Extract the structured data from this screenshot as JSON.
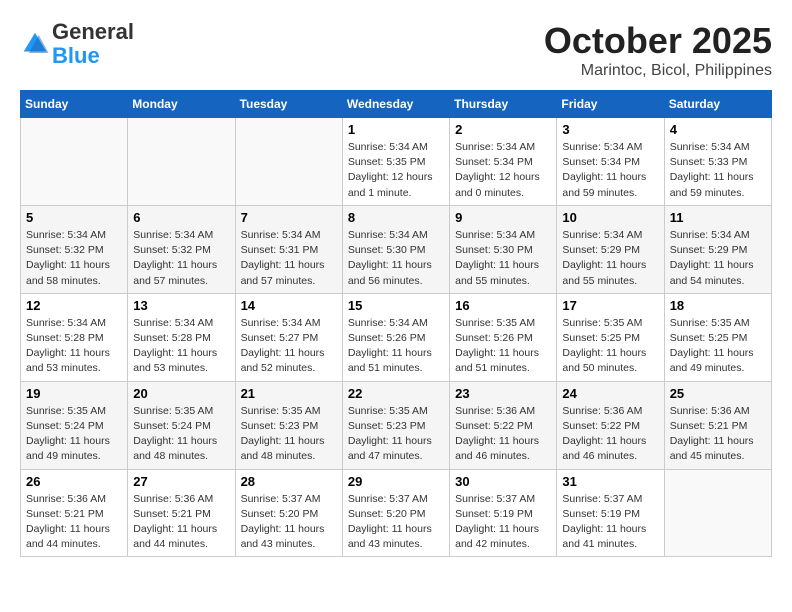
{
  "logo": {
    "general": "General",
    "blue": "Blue"
  },
  "header": {
    "month": "October 2025",
    "location": "Marintoc, Bicol, Philippines"
  },
  "weekdays": [
    "Sunday",
    "Monday",
    "Tuesday",
    "Wednesday",
    "Thursday",
    "Friday",
    "Saturday"
  ],
  "weeks": [
    [
      {
        "day": "",
        "info": ""
      },
      {
        "day": "",
        "info": ""
      },
      {
        "day": "",
        "info": ""
      },
      {
        "day": "1",
        "info": "Sunrise: 5:34 AM\nSunset: 5:35 PM\nDaylight: 12 hours\nand 1 minute."
      },
      {
        "day": "2",
        "info": "Sunrise: 5:34 AM\nSunset: 5:34 PM\nDaylight: 12 hours\nand 0 minutes."
      },
      {
        "day": "3",
        "info": "Sunrise: 5:34 AM\nSunset: 5:34 PM\nDaylight: 11 hours\nand 59 minutes."
      },
      {
        "day": "4",
        "info": "Sunrise: 5:34 AM\nSunset: 5:33 PM\nDaylight: 11 hours\nand 59 minutes."
      }
    ],
    [
      {
        "day": "5",
        "info": "Sunrise: 5:34 AM\nSunset: 5:32 PM\nDaylight: 11 hours\nand 58 minutes."
      },
      {
        "day": "6",
        "info": "Sunrise: 5:34 AM\nSunset: 5:32 PM\nDaylight: 11 hours\nand 57 minutes."
      },
      {
        "day": "7",
        "info": "Sunrise: 5:34 AM\nSunset: 5:31 PM\nDaylight: 11 hours\nand 57 minutes."
      },
      {
        "day": "8",
        "info": "Sunrise: 5:34 AM\nSunset: 5:30 PM\nDaylight: 11 hours\nand 56 minutes."
      },
      {
        "day": "9",
        "info": "Sunrise: 5:34 AM\nSunset: 5:30 PM\nDaylight: 11 hours\nand 55 minutes."
      },
      {
        "day": "10",
        "info": "Sunrise: 5:34 AM\nSunset: 5:29 PM\nDaylight: 11 hours\nand 55 minutes."
      },
      {
        "day": "11",
        "info": "Sunrise: 5:34 AM\nSunset: 5:29 PM\nDaylight: 11 hours\nand 54 minutes."
      }
    ],
    [
      {
        "day": "12",
        "info": "Sunrise: 5:34 AM\nSunset: 5:28 PM\nDaylight: 11 hours\nand 53 minutes."
      },
      {
        "day": "13",
        "info": "Sunrise: 5:34 AM\nSunset: 5:28 PM\nDaylight: 11 hours\nand 53 minutes."
      },
      {
        "day": "14",
        "info": "Sunrise: 5:34 AM\nSunset: 5:27 PM\nDaylight: 11 hours\nand 52 minutes."
      },
      {
        "day": "15",
        "info": "Sunrise: 5:34 AM\nSunset: 5:26 PM\nDaylight: 11 hours\nand 51 minutes."
      },
      {
        "day": "16",
        "info": "Sunrise: 5:35 AM\nSunset: 5:26 PM\nDaylight: 11 hours\nand 51 minutes."
      },
      {
        "day": "17",
        "info": "Sunrise: 5:35 AM\nSunset: 5:25 PM\nDaylight: 11 hours\nand 50 minutes."
      },
      {
        "day": "18",
        "info": "Sunrise: 5:35 AM\nSunset: 5:25 PM\nDaylight: 11 hours\nand 49 minutes."
      }
    ],
    [
      {
        "day": "19",
        "info": "Sunrise: 5:35 AM\nSunset: 5:24 PM\nDaylight: 11 hours\nand 49 minutes."
      },
      {
        "day": "20",
        "info": "Sunrise: 5:35 AM\nSunset: 5:24 PM\nDaylight: 11 hours\nand 48 minutes."
      },
      {
        "day": "21",
        "info": "Sunrise: 5:35 AM\nSunset: 5:23 PM\nDaylight: 11 hours\nand 48 minutes."
      },
      {
        "day": "22",
        "info": "Sunrise: 5:35 AM\nSunset: 5:23 PM\nDaylight: 11 hours\nand 47 minutes."
      },
      {
        "day": "23",
        "info": "Sunrise: 5:36 AM\nSunset: 5:22 PM\nDaylight: 11 hours\nand 46 minutes."
      },
      {
        "day": "24",
        "info": "Sunrise: 5:36 AM\nSunset: 5:22 PM\nDaylight: 11 hours\nand 46 minutes."
      },
      {
        "day": "25",
        "info": "Sunrise: 5:36 AM\nSunset: 5:21 PM\nDaylight: 11 hours\nand 45 minutes."
      }
    ],
    [
      {
        "day": "26",
        "info": "Sunrise: 5:36 AM\nSunset: 5:21 PM\nDaylight: 11 hours\nand 44 minutes."
      },
      {
        "day": "27",
        "info": "Sunrise: 5:36 AM\nSunset: 5:21 PM\nDaylight: 11 hours\nand 44 minutes."
      },
      {
        "day": "28",
        "info": "Sunrise: 5:37 AM\nSunset: 5:20 PM\nDaylight: 11 hours\nand 43 minutes."
      },
      {
        "day": "29",
        "info": "Sunrise: 5:37 AM\nSunset: 5:20 PM\nDaylight: 11 hours\nand 43 minutes."
      },
      {
        "day": "30",
        "info": "Sunrise: 5:37 AM\nSunset: 5:19 PM\nDaylight: 11 hours\nand 42 minutes."
      },
      {
        "day": "31",
        "info": "Sunrise: 5:37 AM\nSunset: 5:19 PM\nDaylight: 11 hours\nand 41 minutes."
      },
      {
        "day": "",
        "info": ""
      }
    ]
  ]
}
